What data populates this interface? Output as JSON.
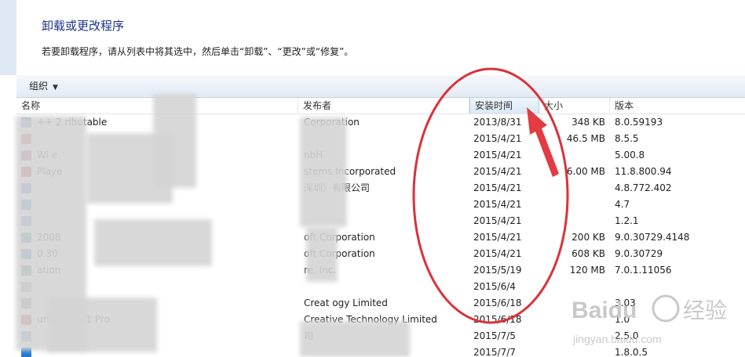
{
  "header": {
    "title": "卸载或更改程序",
    "description": "若要卸载程序，请从列表中将其选中，然后单击“卸载”、“更改”或“修复”。"
  },
  "toolbar": {
    "organize_label": "组织",
    "organize_icon": "chevron-down-icon"
  },
  "columns": {
    "name": "名称",
    "publisher": "发布者",
    "installed_on": "安装时间",
    "size": "大小",
    "version": "版本"
  },
  "sorted_column": "installed_on",
  "programs": [
    {
      "name": "++ 2 ributable",
      "publisher": "Corporation",
      "installed_on": "2013/8/31",
      "size": "348 KB",
      "version": "8.0.59193"
    },
    {
      "name": "",
      "publisher": "",
      "installed_on": "2015/4/21",
      "size": "46.5 MB",
      "version": "8.5.5"
    },
    {
      "name": "Wi e",
      "publisher": "nbH",
      "installed_on": "2015/4/21",
      "size": "",
      "version": "5.00.8"
    },
    {
      "name": "Playe",
      "publisher": "stems Incorporated",
      "installed_on": "2015/4/21",
      "size": "6.00 MB",
      "version": "11.8.800.94"
    },
    {
      "name": "",
      "publisher": "深圳）有限公司",
      "installed_on": "2015/4/21",
      "size": "",
      "version": "4.8.772.402"
    },
    {
      "name": "",
      "publisher": "",
      "installed_on": "2015/4/21",
      "size": "",
      "version": "4.7"
    },
    {
      "name": "",
      "publisher": "",
      "installed_on": "2015/4/21",
      "size": "",
      "version": "1.2.1"
    },
    {
      "name": "2008",
      "publisher": "oft Corporation",
      "installed_on": "2015/4/21",
      "size": "200 KB",
      "version": "9.0.30729.4148"
    },
    {
      "name": "0.30",
      "publisher": "oft Corporation",
      "installed_on": "2015/4/21",
      "size": "608 KB",
      "version": "9.0.30729"
    },
    {
      "name": "ation",
      "publisher": "re, Inc.",
      "installed_on": "2015/5/19",
      "size": "120 MB",
      "version": "7.0.1.11056"
    },
    {
      "name": "",
      "publisher": "",
      "installed_on": "2015/6/4",
      "size": "",
      "version": ""
    },
    {
      "name": "",
      "publisher": "Creat ogy Limited",
      "installed_on": "2015/6/18",
      "size": "",
      "version": "3.03"
    },
    {
      "name": "urround 5.1 Pro",
      "publisher": "Creative Technology Limited",
      "installed_on": "2015/6/18",
      "size": "",
      "version": "1.0"
    },
    {
      "name": "",
      "publisher": "司",
      "installed_on": "2015/7/5",
      "size": "",
      "version": "2.5.0"
    },
    {
      "name": "",
      "publisher": "",
      "installed_on": "2015/7/7",
      "size": "",
      "version": "1.8.0.5"
    }
  ],
  "annotation": {
    "ellipse_color": "#d9333b",
    "arrow_color": "#e23b41"
  },
  "watermark": {
    "brand": "Baidu",
    "cn": "经验",
    "url": "jingyan.baidu.com"
  },
  "icon_colors": [
    "#6b8cc7",
    "#d9532c",
    "#8a3b6b",
    "#c8161d",
    "#3b7bd6",
    "#4a7fc1",
    "#5b8bd1",
    "#3d6ea8",
    "#3d6ea8",
    "#3f7f3f",
    "#9a9a9a",
    "#8a8a8a",
    "#c0392b",
    "#6a9ad6",
    "#1f78d1"
  ]
}
